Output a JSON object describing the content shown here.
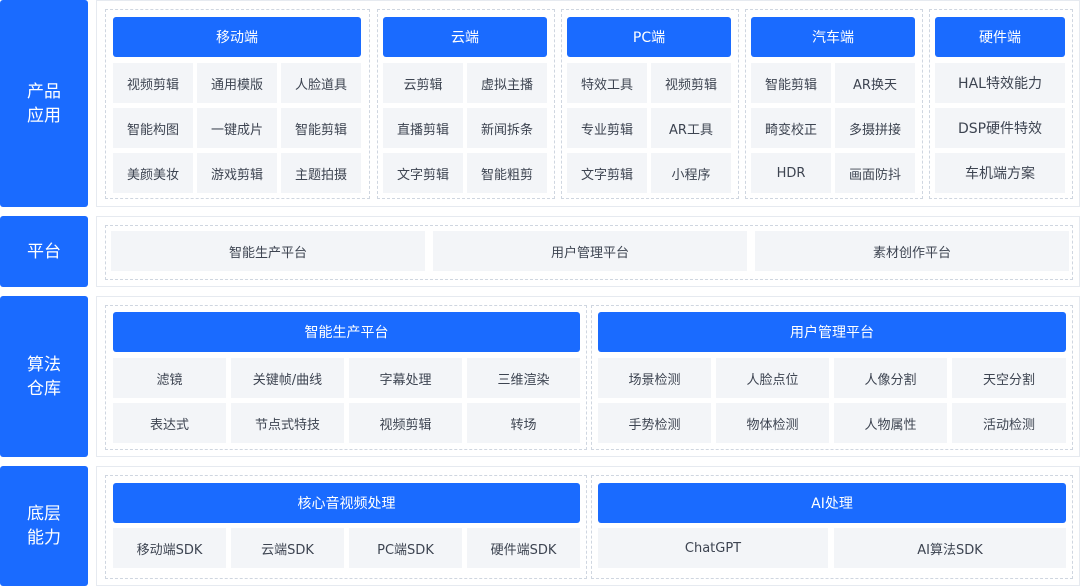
{
  "rows": {
    "product": {
      "label": [
        "产品",
        "应用"
      ],
      "groups": [
        {
          "title": "移动端",
          "items": [
            "视频剪辑",
            "通用模版",
            "人脸道具",
            "智能构图",
            "一键成片",
            "智能剪辑",
            "美颜美妆",
            "游戏剪辑",
            "主题拍摄"
          ]
        },
        {
          "title": "云端",
          "items": [
            "云剪辑",
            "虚拟主播",
            "直播剪辑",
            "新闻拆条",
            "文字剪辑",
            "智能粗剪"
          ]
        },
        {
          "title": "PC端",
          "items": [
            "特效工具",
            "视频剪辑",
            "专业剪辑",
            "AR工具",
            "文字剪辑",
            "小程序"
          ]
        },
        {
          "title": "汽车端",
          "items": [
            "智能剪辑",
            "AR换天",
            "畸变校正",
            "多摄拼接",
            "HDR",
            "画面防抖"
          ]
        },
        {
          "title": "硬件端",
          "items": [
            "HAL特效能力",
            "DSP硬件特效",
            "车机端方案"
          ]
        }
      ]
    },
    "platform": {
      "label": [
        "平台"
      ],
      "items": [
        "智能生产平台",
        "用户管理平台",
        "素材创作平台"
      ]
    },
    "algorithm": {
      "label": [
        "算法",
        "仓库"
      ],
      "groups": [
        {
          "title": "智能生产平台",
          "items": [
            "滤镜",
            "关键帧/曲线",
            "字幕处理",
            "三维渲染",
            "表达式",
            "节点式特技",
            "视频剪辑",
            "转场"
          ]
        },
        {
          "title": "用户管理平台",
          "items": [
            "场景检测",
            "人脸点位",
            "人像分割",
            "天空分割",
            "手势检测",
            "物体检测",
            "人物属性",
            "活动检测"
          ]
        }
      ]
    },
    "base": {
      "label": [
        "底层",
        "能力"
      ],
      "groups": [
        {
          "title": "核心音视频处理",
          "items": [
            "移动端SDK",
            "云端SDK",
            "PC端SDK",
            "硬件端SDK"
          ]
        },
        {
          "title": "AI处理",
          "items": [
            "ChatGPT",
            "AI算法SDK"
          ]
        }
      ]
    }
  },
  "colors": {
    "accent": "#1a6bff",
    "cell_bg": "#f3f5f8",
    "border": "#cfd6e0"
  }
}
